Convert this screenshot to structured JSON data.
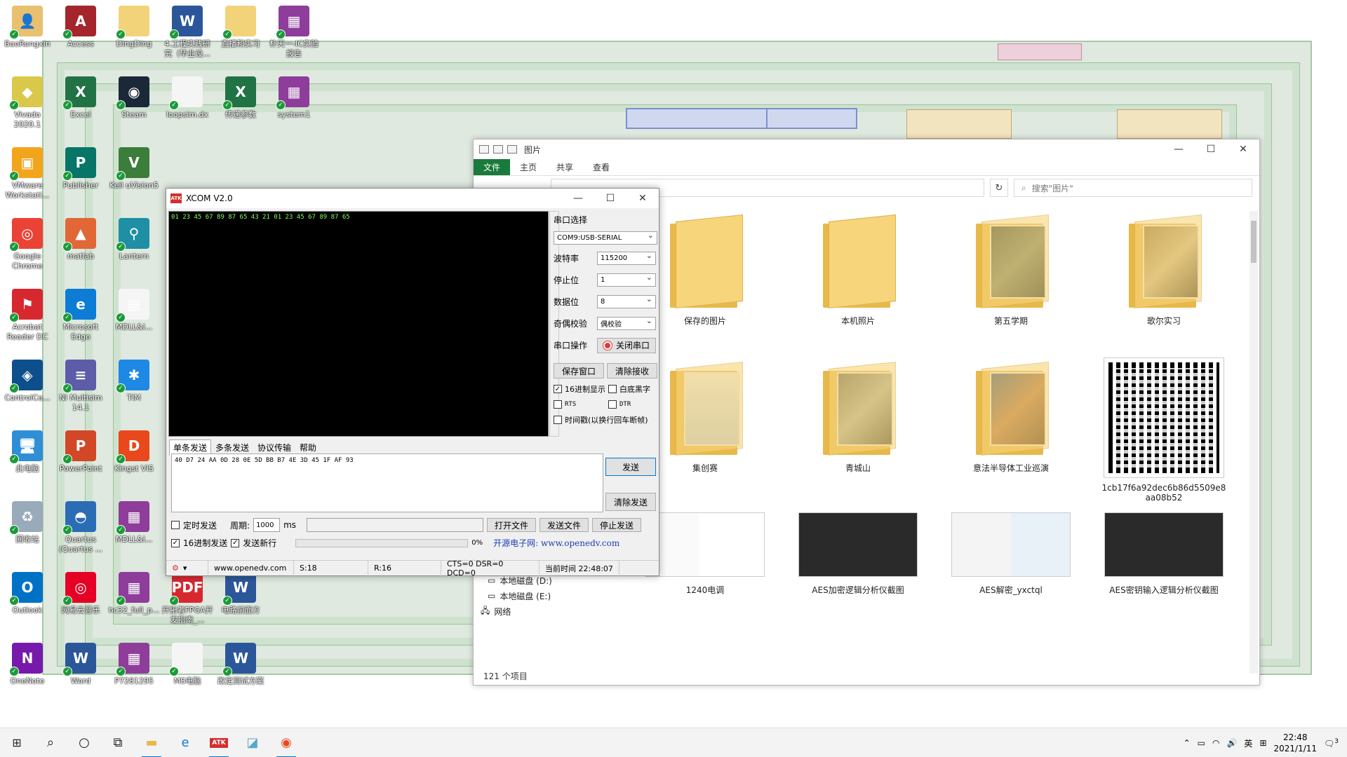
{
  "desktop": {
    "icons": [
      {
        "label": "BaoRongxin",
        "glyph": "👤",
        "color": "#e8c070"
      },
      {
        "label": "Access",
        "glyph": "A",
        "color": "#a4262c"
      },
      {
        "label": "DingDing",
        "glyph": "",
        "color": "#f3d37a"
      },
      {
        "label": "4.工程实践研究（毕业设...",
        "glyph": "W",
        "color": "#2b579a"
      },
      {
        "label": "直播和实习",
        "glyph": "",
        "color": "#f3d37a"
      },
      {
        "label": "朴天一-IC实验报告",
        "glyph": "▦",
        "color": "#8e3d9b"
      },
      {
        "label": "Vivado 2020.1",
        "glyph": "◆",
        "color": "#d9c84a"
      },
      {
        "label": "Excel",
        "glyph": "X",
        "color": "#217346"
      },
      {
        "label": "Steam",
        "glyph": "◉",
        "color": "#1b2838"
      },
      {
        "label": "loopsim.dx",
        "glyph": "",
        "color": "#f5f5f5"
      },
      {
        "label": "传递参数",
        "glyph": "X",
        "color": "#217346"
      },
      {
        "label": "system1",
        "glyph": "▦",
        "color": "#8e3d9b"
      },
      {
        "label": "VMware Workstati...",
        "glyph": "▣",
        "color": "#f2a51a"
      },
      {
        "label": "Publisher",
        "glyph": "P",
        "color": "#077568"
      },
      {
        "label": "Keil uVision5",
        "glyph": "V",
        "color": "#3b7d3b"
      },
      {
        "label": "Google Chrome",
        "glyph": "◎",
        "color": "#ea4335"
      },
      {
        "label": "matlab",
        "glyph": "▲",
        "color": "#e16737"
      },
      {
        "label": "Lantern",
        "glyph": "⚲",
        "color": "#1f8fa6"
      },
      {
        "label": "Acrobat Reader DC",
        "glyph": "⚑",
        "color": "#d7282f"
      },
      {
        "label": "Microsoft Edge",
        "glyph": "e",
        "color": "#0c7cd5"
      },
      {
        "label": "MDLL&l...",
        "glyph": "▤",
        "color": "#f5f5f5"
      },
      {
        "label": "ControlCe...",
        "glyph": "◈",
        "color": "#0d4f8c"
      },
      {
        "label": "NI Multisim 14.1",
        "glyph": "≡",
        "color": "#5c5ca8"
      },
      {
        "label": "TIM",
        "glyph": "✱",
        "color": "#1e88e5"
      },
      {
        "label": "此电脑",
        "glyph": "🖥",
        "color": "#2f8fd6"
      },
      {
        "label": "PowerPoint",
        "glyph": "P",
        "color": "#d24726"
      },
      {
        "label": "Kingst VIS",
        "glyph": "D",
        "color": "#e8481c"
      },
      {
        "label": "回收站",
        "glyph": "♻",
        "color": "#9ab"
      },
      {
        "label": "Quartus (Quartus ...",
        "glyph": "◓",
        "color": "#2a6db5"
      },
      {
        "label": "MDLL&l...",
        "glyph": "▦",
        "color": "#8e3d9b"
      },
      {
        "label": "Outlook",
        "glyph": "O",
        "color": "#0072c6"
      },
      {
        "label": "网易云音乐",
        "glyph": "◎",
        "color": "#e60026"
      },
      {
        "label": "hc32_full_p...",
        "glyph": "▦",
        "color": "#8e3d9b"
      },
      {
        "label": "开拓者FPGA开发指南_...",
        "glyph": "PDF",
        "color": "#d7282f"
      },
      {
        "label": "电路前面方",
        "glyph": "W",
        "color": "#2b579a"
      },
      {
        "label": "OneNote",
        "glyph": "N",
        "color": "#7719aa"
      },
      {
        "label": "Word",
        "glyph": "W",
        "color": "#2b579a"
      },
      {
        "label": "P7281295",
        "glyph": "▦",
        "color": "#8e3d9b"
      },
      {
        "label": "MS电脑",
        "glyph": "",
        "color": "#f5f5f5"
      },
      {
        "label": "改定测试方案",
        "glyph": "W",
        "color": "#2b579a"
      }
    ]
  },
  "explorer": {
    "title": "图片",
    "ribbon": [
      "文件",
      "主页",
      "共享",
      "查看"
    ],
    "search_placeholder": "搜索\"图片\"",
    "items": [
      {
        "label": "保存的图片"
      },
      {
        "label": "本机照片"
      },
      {
        "label": "第五学期"
      },
      {
        "label": "歌尔实习"
      },
      {
        "label": "集创赛"
      },
      {
        "label": "青城山"
      },
      {
        "label": "意法半导体工业巡演"
      },
      {
        "label": "1cb17f6a92dec6b86d5509e8aa08b52"
      },
      {
        "label": "1240电调"
      },
      {
        "label": "AES加密逻辑分析仪截图"
      },
      {
        "label": "AES解密_yxctql"
      },
      {
        "label": "AES密钥输入逻辑分析仪截图"
      }
    ],
    "nav": [
      "本地磁盘 (D:)",
      "本地磁盘 (E:)",
      "网络"
    ],
    "status": "121 个项目"
  },
  "xcom": {
    "title": "XCOM V2.0",
    "recv_text": "01 23 45 67 89 87 65 43 21 01 23 45 67 89 87 65",
    "serial_select_label": "串口选择",
    "port": "COM9:USB-SERIAL",
    "baud_label": "波特率",
    "baud": "115200",
    "stop_label": "停止位",
    "stop": "1",
    "data_label": "数据位",
    "data": "8",
    "parity_label": "奇偶校验",
    "parity": "偶校验",
    "op_label": "串口操作",
    "op_button": "关闭串口",
    "save_window": "保存窗口",
    "clear_recv": "清除接收",
    "hex_display": "16进制显示",
    "white_bg": "白底黑字",
    "rts": "RTS",
    "dtr": "DTR",
    "timestamp": "时间戳(以换行回车断帧)",
    "tabs": [
      "单条发送",
      "多条发送",
      "协议传输",
      "帮助"
    ],
    "send_text": "40 D7 24 AA 0D 28 0E 5D BB B7 4E 3D 45 1F AF 93",
    "send_button": "发送",
    "clear_send": "清除发送",
    "timed_send": "定时发送",
    "period_label": "周期:",
    "period": "1000",
    "ms": "ms",
    "open_file": "打开文件",
    "send_file": "发送文件",
    "stop_send": "停止发送",
    "hex_send": "16进制发送",
    "send_newline": "发送新行",
    "progress": "0%",
    "site_text": "开源电子网: www.openedv.com",
    "status_url": "www.openedv.com",
    "status_s": "S:18",
    "status_r": "R:16",
    "status_lines": "CTS=0 DSR=0 DCD=0",
    "status_time": "当前时间 22:48:07"
  },
  "taskbar": {
    "time": "22:48",
    "date": "2021/1/11",
    "ime": "英",
    "notif_count": "3"
  }
}
